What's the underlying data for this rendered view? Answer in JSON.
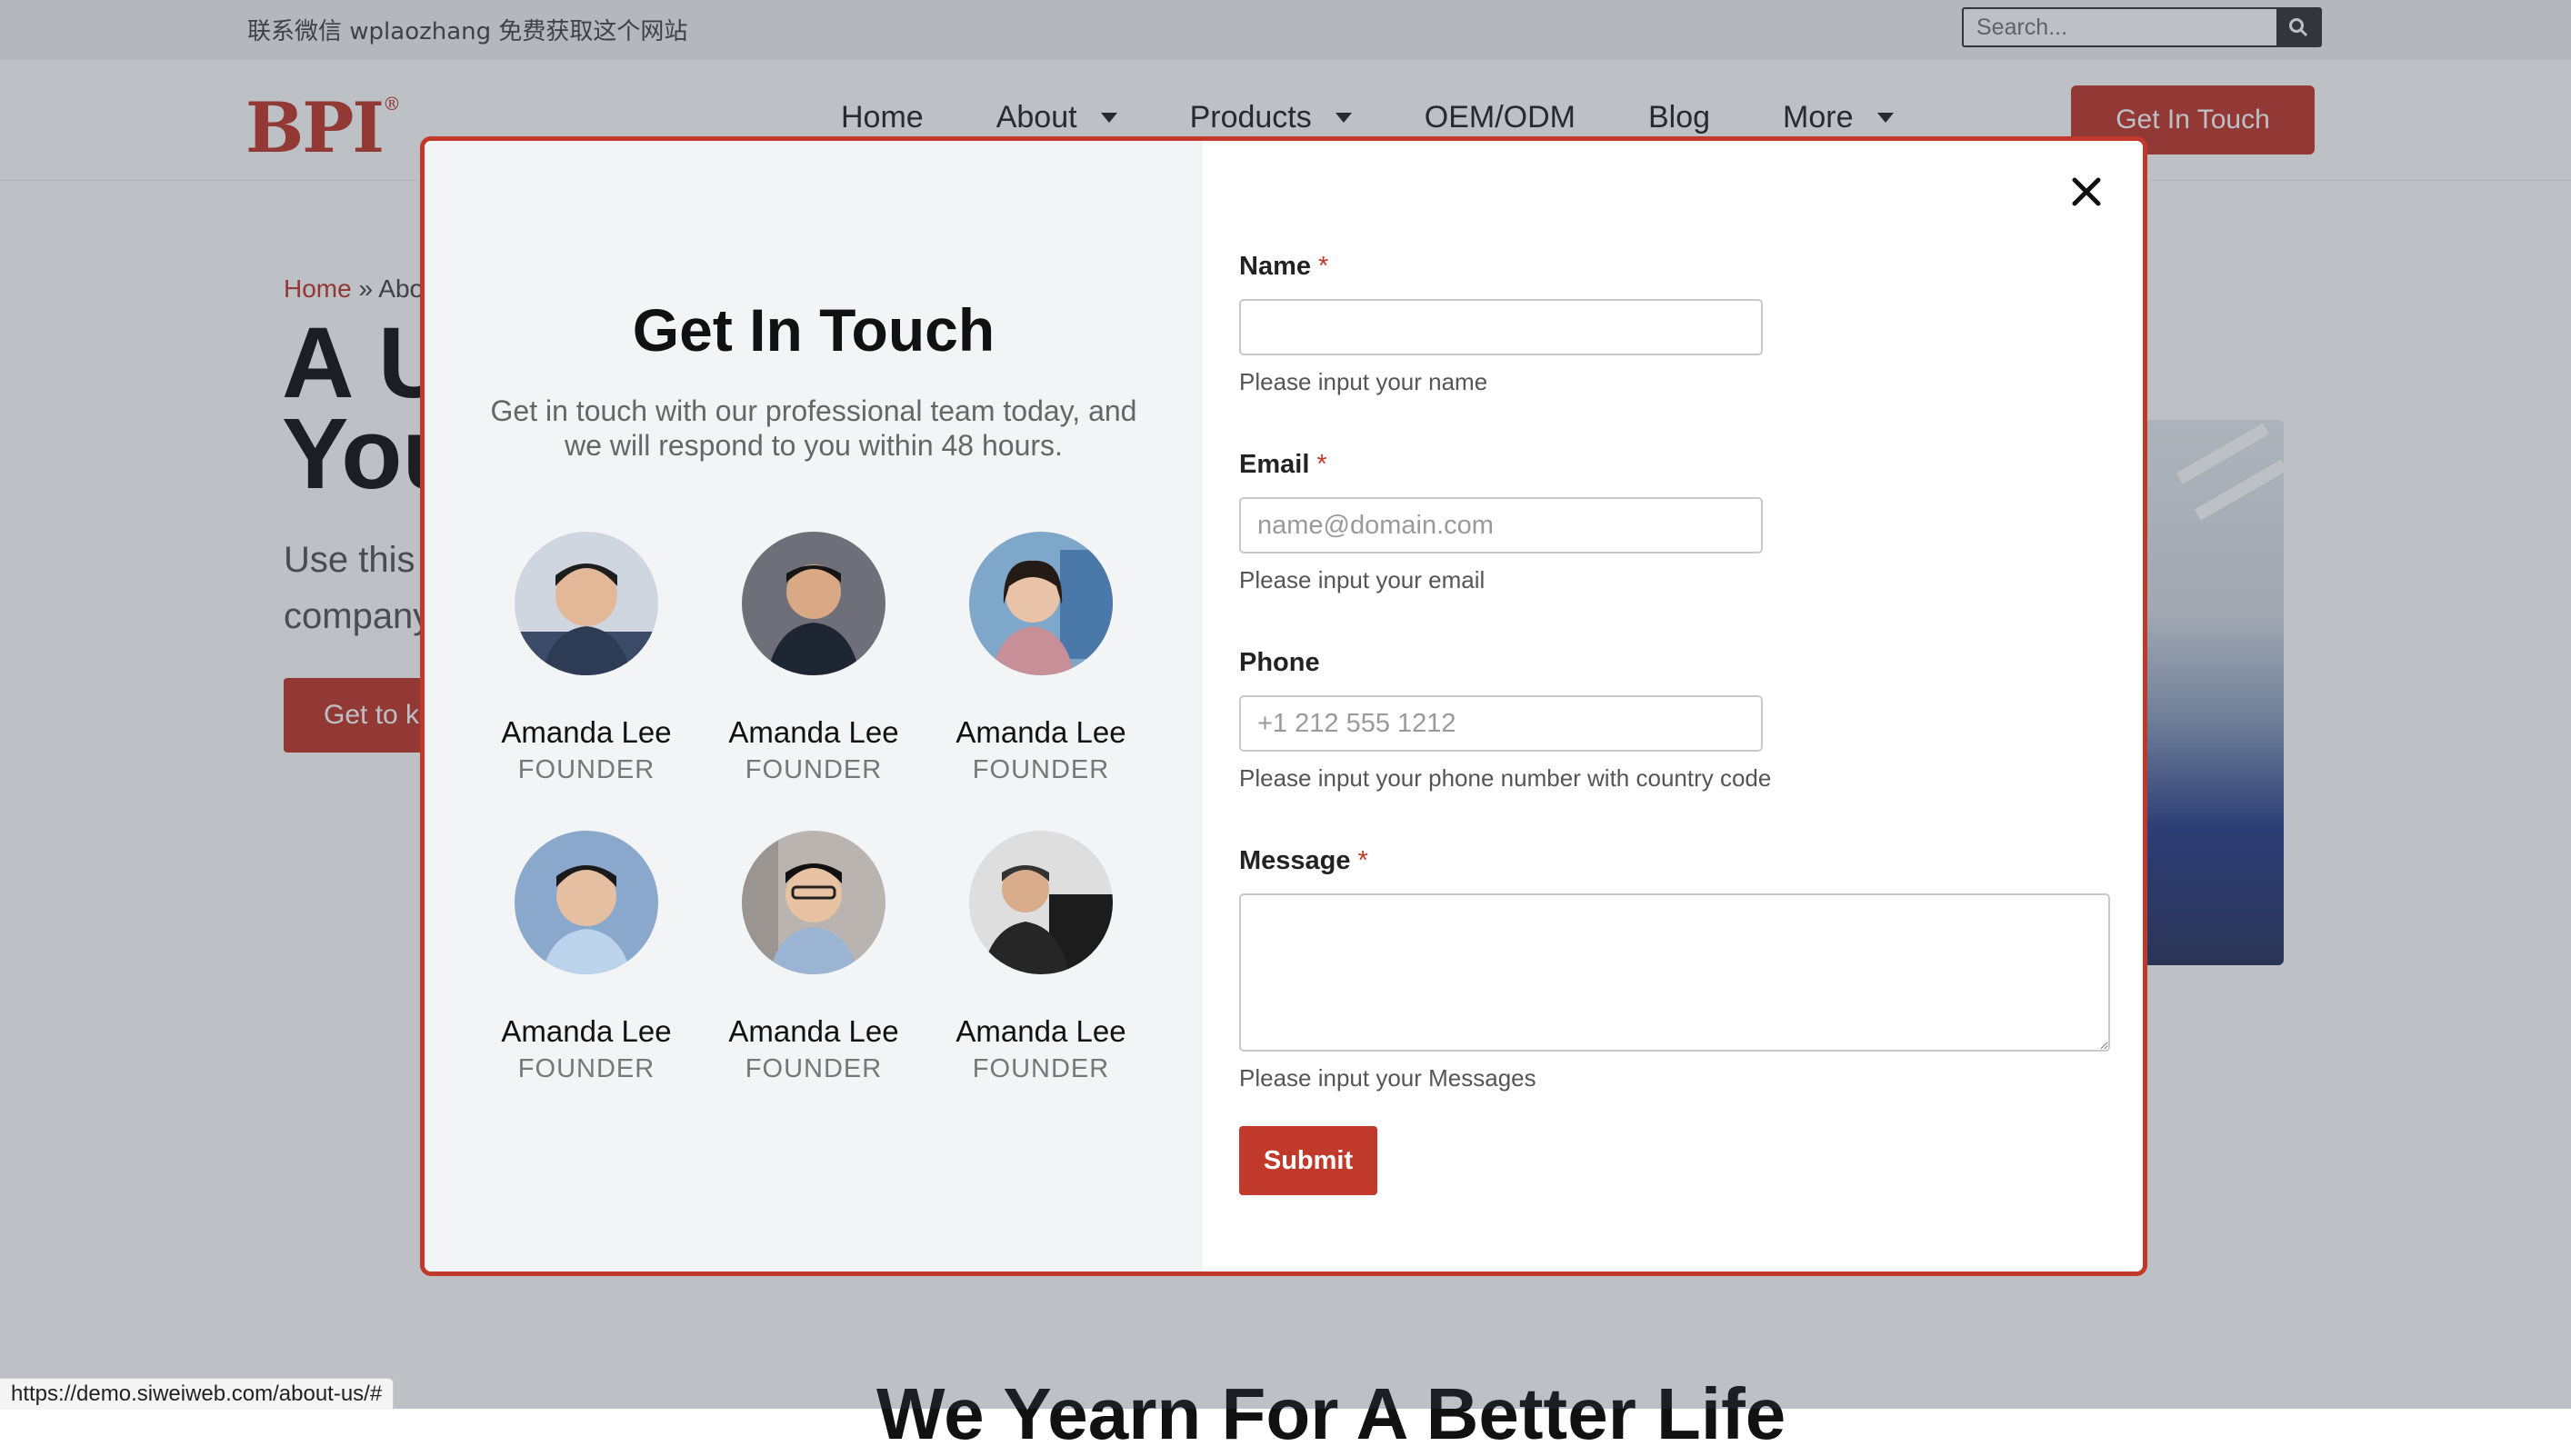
{
  "topbar": {
    "contact_text": "联系微信 wplaozhang 免费获取这个网站",
    "search_placeholder": "Search..."
  },
  "header": {
    "logo_text": "BPI",
    "logo_mark": "®",
    "nav": [
      {
        "label": "Home",
        "has_dropdown": false
      },
      {
        "label": "About",
        "has_dropdown": true
      },
      {
        "label": "Products",
        "has_dropdown": true
      },
      {
        "label": "OEM/ODM",
        "has_dropdown": false
      },
      {
        "label": "Blog",
        "has_dropdown": false
      },
      {
        "label": "More",
        "has_dropdown": true
      }
    ],
    "cta_label": "Get In Touch"
  },
  "hero": {
    "breadcrumb_home": "Home",
    "breadcrumb_sep": " » ",
    "breadcrumb_current": "Abo",
    "title_line1": "A U",
    "title_line2": "You",
    "sub_line1": "Use this",
    "sub_line2": "company",
    "button_label": "Get to k"
  },
  "section2": {
    "title": "We Yearn For A Better Life"
  },
  "modal": {
    "title": "Get In Touch",
    "description": "Get in touch with our professional team today, and we will respond to you within 48 hours.",
    "team": [
      {
        "name": "Amanda Lee",
        "role": "FOUNDER"
      },
      {
        "name": "Amanda Lee",
        "role": "FOUNDER"
      },
      {
        "name": "Amanda Lee",
        "role": "FOUNDER"
      },
      {
        "name": "Amanda Lee",
        "role": "FOUNDER"
      },
      {
        "name": "Amanda Lee",
        "role": "FOUNDER"
      },
      {
        "name": "Amanda Lee",
        "role": "FOUNDER"
      }
    ],
    "form": {
      "name_label": "Name",
      "name_value": "",
      "name_help": "Please input your name",
      "email_label": "Email",
      "email_placeholder": "name@domain.com",
      "email_help": "Please input your email",
      "phone_label": "Phone",
      "phone_placeholder": "+1 212 555 1212",
      "phone_help": "Please input your phone number with country code",
      "message_label": "Message",
      "message_help": "Please input your Messages",
      "required_mark": "*",
      "submit_label": "Submit"
    }
  },
  "statusbar": {
    "url": "https://demo.siweiweb.com/about-us/#"
  },
  "colors": {
    "accent": "#c0392b",
    "modal_left_bg": "#f3f4f5",
    "overlay": "rgba(50,60,75,0.32)"
  },
  "icons": {
    "search": "search-icon",
    "close": "close-icon",
    "caret": "caret-down-icon"
  }
}
